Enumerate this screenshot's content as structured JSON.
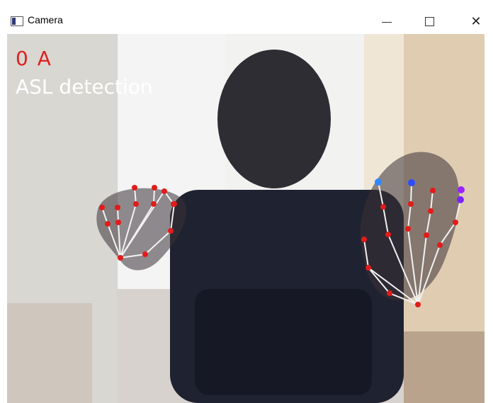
{
  "window": {
    "title": "Camera",
    "controls": {
      "minimize": "—",
      "maximize": "☐",
      "close": "✕"
    }
  },
  "overlay": {
    "status": "0 A",
    "caption": "ASL detection",
    "status_color": "#e02020",
    "caption_color": "#ffffff"
  },
  "hands": {
    "keypoint_color": "#e21b1b",
    "skeleton_color": "#f2f2f2"
  }
}
